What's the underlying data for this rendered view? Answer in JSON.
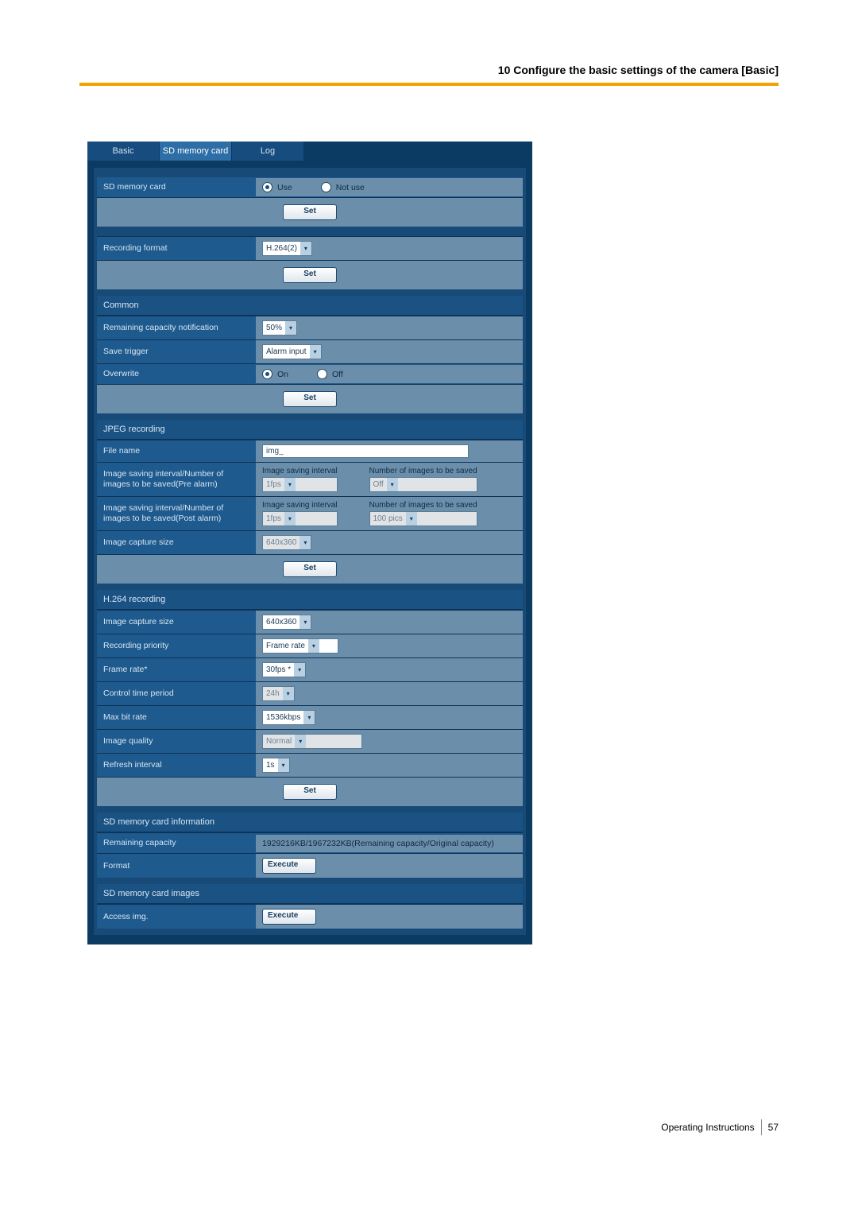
{
  "header": {
    "title": "10 Configure the basic settings of the camera [Basic]"
  },
  "footer": {
    "text": "Operating Instructions",
    "page": "57"
  },
  "tabs": {
    "basic": "Basic",
    "sd": "SD memory card",
    "log": "Log"
  },
  "buttons": {
    "set": "Set",
    "execute": "Execute"
  },
  "sd_card": {
    "label": "SD memory card",
    "use": "Use",
    "not_use": "Not use"
  },
  "recording_format": {
    "label": "Recording format",
    "value": "H.264(2)"
  },
  "common": {
    "header": "Common",
    "remaining_notif_label": "Remaining capacity notification",
    "remaining_notif_value": "50%",
    "save_trigger_label": "Save trigger",
    "save_trigger_value": "Alarm input",
    "overwrite_label": "Overwrite",
    "overwrite_on": "On",
    "overwrite_off": "Off"
  },
  "jpeg": {
    "header": "JPEG recording",
    "file_name_label": "File name",
    "file_name_value": "img_",
    "pre_label": "Image saving interval/Number of images to be saved(Pre alarm)",
    "post_label": "Image saving interval/Number of images to be saved(Post alarm)",
    "interval_label": "Image saving interval",
    "num_images_label": "Number of images to be saved",
    "pre_interval": "1fps",
    "pre_count": "Off",
    "post_interval": "1fps",
    "post_count": "100 pics",
    "capture_label": "Image capture size",
    "capture_value": "640x360"
  },
  "h264": {
    "header": "H.264 recording",
    "capture_label": "Image capture size",
    "capture_value": "640x360",
    "priority_label": "Recording priority",
    "priority_value": "Frame rate",
    "framerate_label": "Frame rate*",
    "framerate_value": "30fps *",
    "control_label": "Control time period",
    "control_value": "24h",
    "maxbitrate_label": "Max bit rate",
    "maxbitrate_value": "1536kbps",
    "quality_label": "Image quality",
    "quality_value": "Normal",
    "refresh_label": "Refresh interval",
    "refresh_value": "1s"
  },
  "info": {
    "header": "SD memory card information",
    "remaining_label": "Remaining capacity",
    "remaining_value": "1929216KB/1967232KB(Remaining capacity/Original capacity)",
    "format_label": "Format"
  },
  "images": {
    "header": "SD memory card images",
    "access_label": "Access img."
  }
}
